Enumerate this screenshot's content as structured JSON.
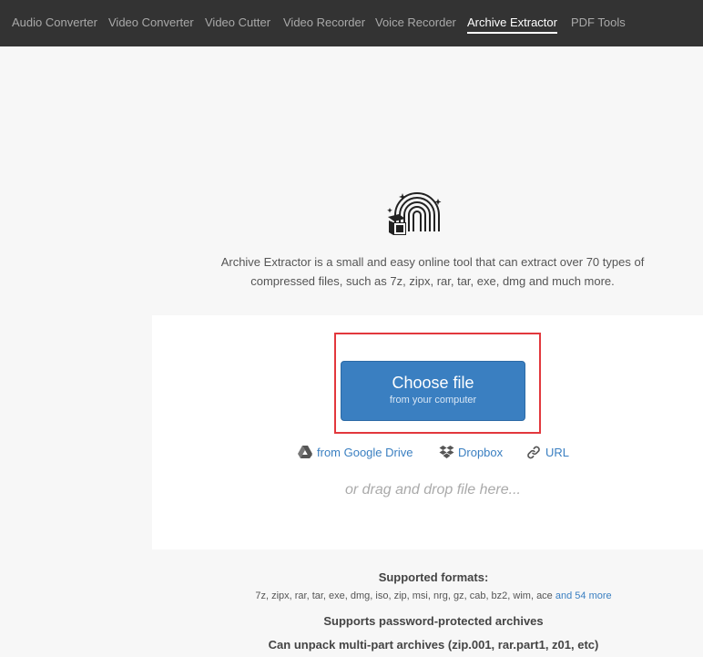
{
  "nav": {
    "items": [
      {
        "label": "Audio Converter",
        "active": false
      },
      {
        "label": "Video Converter",
        "active": false
      },
      {
        "label": "Video Cutter",
        "active": false
      },
      {
        "label": "Video Recorder",
        "active": false
      },
      {
        "label": "Voice Recorder",
        "active": false
      },
      {
        "label": "Archive Extractor",
        "active": true
      },
      {
        "label": "PDF Tools",
        "active": false
      }
    ]
  },
  "intro": {
    "line1": "Archive Extractor is a small and easy online tool that can extract over 70 types of",
    "line2": "compressed files, such as 7z, zipx, rar, tar, exe, dmg and much more."
  },
  "upload": {
    "button_main": "Choose file",
    "button_sub": "from your computer",
    "sources": [
      {
        "label": "from Google Drive",
        "icon": "google-drive-icon"
      },
      {
        "label": "Dropbox",
        "icon": "dropbox-icon"
      },
      {
        "label": "URL",
        "icon": "link-icon"
      }
    ],
    "drop_hint": "or drag and drop file here..."
  },
  "formats": {
    "title": "Supported formats:",
    "list": "7z, zipx, rar, tar, exe, dmg, iso, zip, msi, nrg, gz, cab, bz2, wim, ace",
    "more_link": "and 54 more"
  },
  "features": [
    "Supports password-protected archives",
    "Can unpack multi-part archives (zip.001, rar.part1, z01, etc)"
  ],
  "colors": {
    "nav_bg": "#333333",
    "accent": "#3a7fc1",
    "highlight": "#e2383d"
  }
}
